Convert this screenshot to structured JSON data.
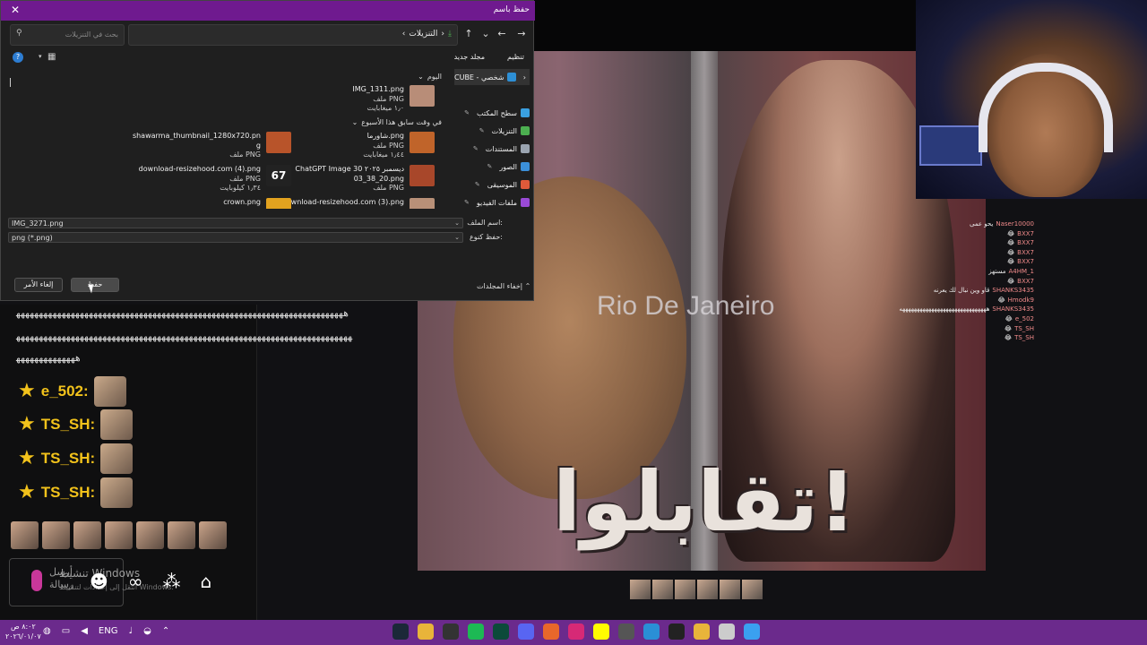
{
  "dialog": {
    "title": "حفظ باسم",
    "breadcrumb": "التنزيلات",
    "search_placeholder": "بحث في التنزيلات",
    "organize": "تنظيم",
    "new_folder": "مجلد جديد",
    "sidebar": [
      {
        "label": "CUBE - شخصي",
        "color": "#2d8fd5"
      },
      {
        "label": "سطح المكتب",
        "color": "#3aa0e0"
      },
      {
        "label": "التنزيلات",
        "color": "#4caf50"
      },
      {
        "label": "المستندات",
        "color": "#9aa4b0"
      },
      {
        "label": "الصور",
        "color": "#3b8fd9"
      },
      {
        "label": "الموسيقى",
        "color": "#e05a3a"
      },
      {
        "label": "ملفات الفيديو",
        "color": "#9a4ad6"
      }
    ],
    "groups": {
      "today": "اليوم",
      "earlier_week": "في وقت سابق هذا الأسبوع"
    },
    "files": [
      {
        "name": "IMG_1311.png",
        "type": "ملف PNG",
        "size": "١٫٠ ميغابايت",
        "thumb": "#b88d78"
      },
      {
        "name": "شاورما.png",
        "type": "ملف PNG",
        "size": "١٫٤٤ ميغابايت",
        "thumb": "#c0642a"
      },
      {
        "name": "shawarma_thumbnail_1280x720.pn",
        "name2": "g",
        "type": "ملف PNG",
        "size": "",
        "thumb": "#b8542a"
      },
      {
        "name": "ChatGPT Image 30 ديسمبر ٢٠٢٥",
        "name2": "03_38_20.png",
        "type": "ملف PNG",
        "size": "",
        "thumb": "#a8472a"
      },
      {
        "name": "download-resizehood.com (4).png",
        "type": "ملف PNG",
        "size": "١٫٣٤ كيلوبايت",
        "thumb": "#222222",
        "thumb_text": "67"
      },
      {
        "name": "download-resizehood.com (3).png",
        "type": "ملف PNG",
        "size": "",
        "thumb": "#b89078"
      },
      {
        "name": "crown.png",
        "type": "ملف PNG",
        "size": "",
        "thumb": "#e2a21f"
      }
    ],
    "filename_label": "اسم الملف:",
    "filename_value": "IMG_3271.png",
    "savetype_label": "حفظ كنوع:",
    "savetype_value": "png (*.png)",
    "hide_folders": "إخفاء المجلدات",
    "save_btn": "حفظ",
    "cancel_btn": "إلغاء الأمر"
  },
  "video": {
    "city_text": "Rio De Janeiro",
    "caption": "تقابلوا!"
  },
  "overlay_chat": [
    {
      "name": "Naser10000",
      "msg": "يحو عمى"
    },
    {
      "name": "BXX7",
      "msg": "😂"
    },
    {
      "name": "BXX7",
      "msg": "😂"
    },
    {
      "name": "BXX7",
      "msg": "😂"
    },
    {
      "name": "BXX7",
      "msg": "😂"
    },
    {
      "name": "A4HM_1",
      "msg": "مستهز"
    },
    {
      "name": "BXX7",
      "msg": "😂"
    },
    {
      "name": "SHANKS3435",
      "msg": "قاو وين نبال لك يعرنه"
    },
    {
      "name": "Hmodk9",
      "msg": "😂"
    },
    {
      "name": "SHANKS3435",
      "msg": "ههههههههههههههههههههههههههههههه"
    },
    {
      "name": "e_502",
      "msg": "😂"
    },
    {
      "name": "TS_SH",
      "msg": "😂"
    },
    {
      "name": "TS_SH",
      "msg": "😂"
    }
  ],
  "left_chat": {
    "spam1": "ﻫﻬﻬﻬﻬﻬﻬﻬﻬﻬﻬﻬﻬﻬﻬﻬﻬﻬﻬﻬﻬﻬﻬﻬﻬﻬﻬﻬﻬﻬﻬﻬﻬﻬﻬﻬﻬﻬﻬﻬﻬﻬﻬﻬﻬﻬﻬﻬﻬﻬﻬﻬﻬﻬﻬﻬﻬﻬﻬﻬﻬﻬﻬﻬﻬﻬﻬﻬﻬﻬﻬﻬﻬ",
    "spam2": "ﻬﻬﻬﻬﻬﻬﻬﻬﻬﻬﻬﻬﻬﻬﻬﻬﻬﻬﻬﻬﻬﻬﻬﻬﻬﻬﻬﻬﻬﻬﻬﻬﻬﻬﻬﻬﻬﻬﻬﻬﻬﻬﻬﻬﻬﻬﻬﻬﻬﻬﻬﻬﻬﻬﻬﻬﻬﻬﻬﻬﻬﻬﻬﻬﻬﻬﻬﻬﻬﻬﻬﻬﻬﻬ",
    "spam3": "ﻫﻬﻬﻬﻬﻬﻬﻬﻬﻬﻬﻬﻬﻬ",
    "entries": [
      {
        "name": "e_502:"
      },
      {
        "name": "TS_SH:"
      },
      {
        "name": "TS_SH:"
      },
      {
        "name": "TS_SH:"
      }
    ],
    "input_placeholder": "أرسل رسالة",
    "activate_title": "تنشيط Windows",
    "activate_sub": "انتقل إلى إعدادات لتنشيط Windows."
  },
  "taskbar": {
    "clock_time": "٨:٠٢ ص",
    "clock_date": "٢٠٢٦/٠١/٠٧",
    "language": "ENG",
    "apps": [
      {
        "name": "steam-icon",
        "color": "#1b2838"
      },
      {
        "name": "chrome-icon",
        "color": "#e8b43a"
      },
      {
        "name": "obs-icon",
        "color": "#333333"
      },
      {
        "name": "spotify-icon",
        "color": "#1db954"
      },
      {
        "name": "terminal-icon",
        "color": "#0c4a3a"
      },
      {
        "name": "discord-icon",
        "color": "#5865f2"
      },
      {
        "name": "firefox-icon",
        "color": "#e8672a"
      },
      {
        "name": "instagram-icon",
        "color": "#d62976"
      },
      {
        "name": "snapchat-icon",
        "color": "#fffc00"
      },
      {
        "name": "media-icon",
        "color": "#555555"
      },
      {
        "name": "edge-icon",
        "color": "#2a8fd6"
      },
      {
        "name": "capcut-icon",
        "color": "#222222"
      },
      {
        "name": "folder-icon",
        "color": "#e8b43a"
      },
      {
        "name": "notes-icon",
        "color": "#cccccc"
      },
      {
        "name": "windows-icon",
        "color": "#3aa0f0"
      }
    ]
  }
}
